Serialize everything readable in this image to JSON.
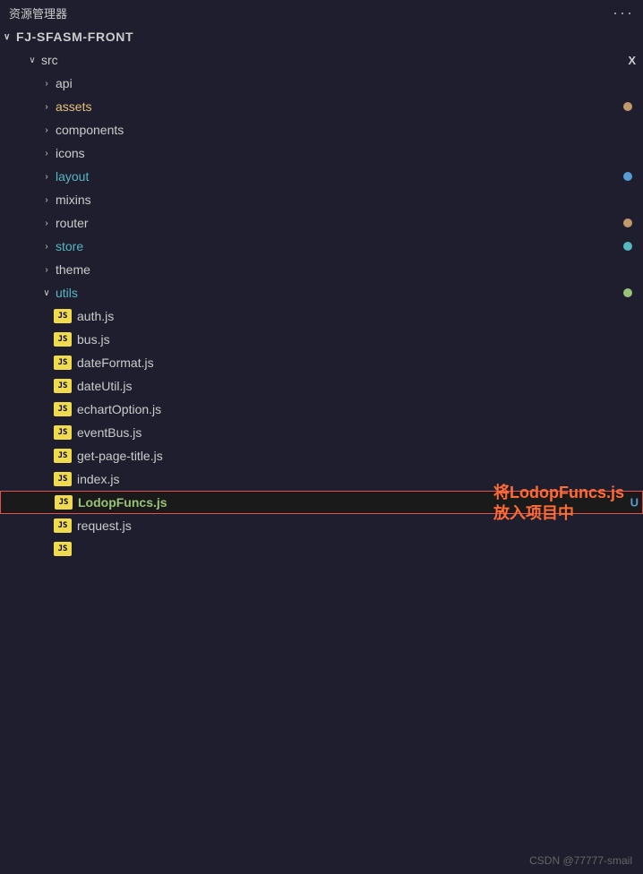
{
  "topbar": {
    "title": "资源管理器",
    "dots": "···"
  },
  "root": {
    "label": "FJ-SFASM-FRONT",
    "chevron": "∨"
  },
  "tree": {
    "src": {
      "label": "src",
      "chevron_open": "∨",
      "chevron_closed": "›"
    },
    "items": [
      {
        "id": "api",
        "type": "folder",
        "label": "api",
        "chevron": "›",
        "indent": 2,
        "color": "normal",
        "dot": null
      },
      {
        "id": "assets",
        "type": "folder",
        "label": "assets",
        "chevron": "›",
        "indent": 2,
        "color": "yellow",
        "dot": "brown"
      },
      {
        "id": "components",
        "type": "folder",
        "label": "components",
        "chevron": "›",
        "indent": 2,
        "color": "normal",
        "dot": null
      },
      {
        "id": "icons",
        "type": "folder",
        "label": "icons",
        "chevron": "›",
        "indent": 2,
        "color": "normal",
        "dot": null
      },
      {
        "id": "layout",
        "type": "folder",
        "label": "layout",
        "chevron": "›",
        "indent": 2,
        "color": "cyan",
        "dot": "blue"
      },
      {
        "id": "mixins",
        "type": "folder",
        "label": "mixins",
        "chevron": "›",
        "indent": 2,
        "color": "normal",
        "dot": null
      },
      {
        "id": "router",
        "type": "folder",
        "label": "router",
        "chevron": "›",
        "indent": 2,
        "color": "normal",
        "dot": "brown"
      },
      {
        "id": "store",
        "type": "folder",
        "label": "store",
        "chevron": "›",
        "indent": 2,
        "color": "cyan",
        "dot": "teal"
      },
      {
        "id": "theme",
        "type": "folder",
        "label": "theme",
        "chevron": "›",
        "indent": 2,
        "color": "normal",
        "dot": null
      },
      {
        "id": "utils",
        "type": "folder",
        "label": "utils",
        "chevron": "∨",
        "indent": 2,
        "color": "cyan",
        "dot": "green"
      }
    ],
    "files": [
      {
        "id": "auth",
        "label": "auth.js",
        "active": false
      },
      {
        "id": "bus",
        "label": "bus.js",
        "active": false
      },
      {
        "id": "dateFormat",
        "label": "dateFormat.js",
        "active": false
      },
      {
        "id": "dateUtil",
        "label": "dateUtil.js",
        "active": false
      },
      {
        "id": "echartOption",
        "label": "echartOption.js",
        "active": false
      },
      {
        "id": "eventBus",
        "label": "eventBus.js",
        "active": false
      },
      {
        "id": "getPageTitle",
        "label": "get-page-title.js",
        "active": false
      },
      {
        "id": "index",
        "label": "index.js",
        "active": false
      },
      {
        "id": "LodopFuncs",
        "label": "LodopFuncs.js",
        "active": true
      },
      {
        "id": "request",
        "label": "request.js",
        "active": false
      }
    ]
  },
  "annotation": {
    "line1": "将LodopFuncs.js",
    "line2": "放入项目中"
  },
  "watermark": "CSDN @77777-smail",
  "badge": {
    "text": "JS"
  },
  "labels": {
    "u": "U",
    "x": "X"
  }
}
